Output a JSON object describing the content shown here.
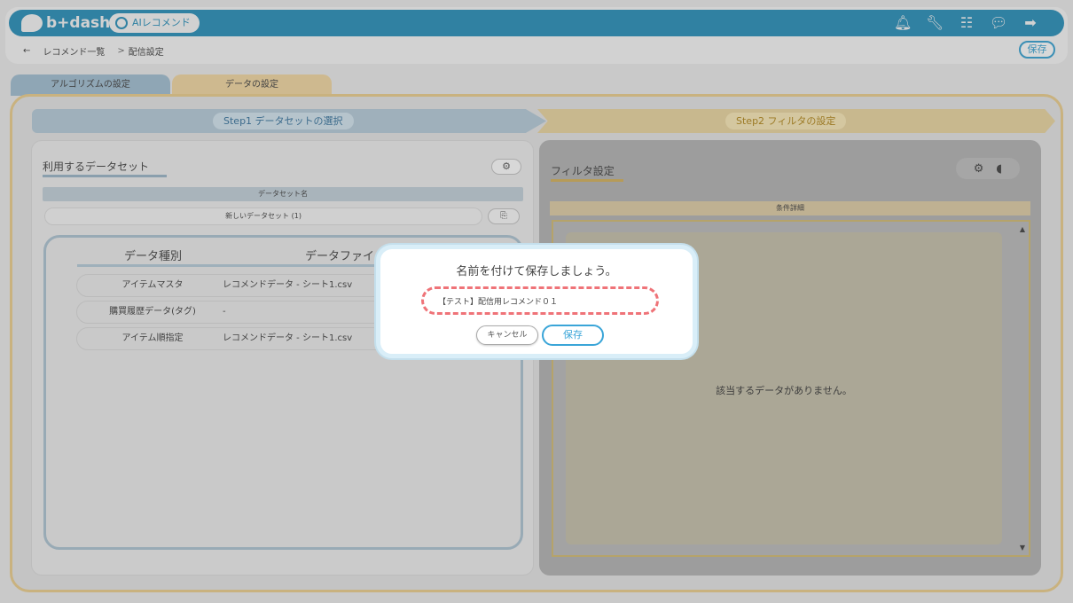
{
  "header": {
    "logo_text": "b+dash",
    "ai_pill": "AIレコメンド",
    "icons": [
      "bell-icon",
      "wrench-icon",
      "grid-icon",
      "chat-icon",
      "logout-icon"
    ]
  },
  "breadcrumb": {
    "back": "←",
    "parent": "レコメンド一覧",
    "sep": ">",
    "current": "配信設定"
  },
  "top_save": "保存",
  "tabs": [
    "アルゴリズムの設定",
    "データの設定"
  ],
  "steps": [
    "Step1 データセットの選択",
    "Step2 フィルタの設定"
  ],
  "left_panel": {
    "title": "利用するデータセット",
    "dataset_header": "データセット名",
    "dataset_name": "新しいデータセット (1)",
    "columns": [
      "データ種別",
      "データファイル"
    ],
    "rows": [
      {
        "type": "アイテムマスタ",
        "file": "レコメンドデータ - シート1.csv"
      },
      {
        "type": "購買履歴データ(タグ)",
        "file": "-"
      },
      {
        "type": "アイテム順指定",
        "file": "レコメンドデータ - シート1.csv"
      }
    ]
  },
  "right_panel": {
    "title": "フィルタ設定",
    "condition_header": "条件詳細",
    "empty_message": "該当するデータがありません。"
  },
  "modal": {
    "title": "名前を付けて保存しましょう。",
    "input_value": "【テスト】配信用レコメンド０１",
    "cancel": "キャンセル",
    "save": "保存"
  }
}
